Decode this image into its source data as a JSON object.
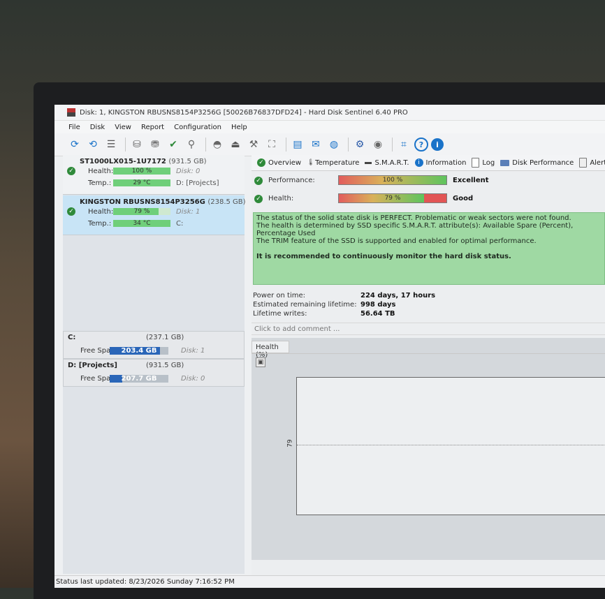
{
  "window": {
    "title": "Disk: 1, KINGSTON RBUSNS8154P3256G [50026B76837DFD24]  -  Hard Disk Sentinel 6.40 PRO"
  },
  "menu": [
    "File",
    "Disk",
    "View",
    "Report",
    "Configuration",
    "Help"
  ],
  "toolbar": {
    "icons": [
      "refresh-icon",
      "refresh-warning-icon",
      "list-icon",
      "disk-test-icon",
      "disk-schedule-icon",
      "disk-check-icon",
      "disk-search-icon",
      "drive-icon",
      "eject-icon",
      "tools-icon",
      "drive-share-icon",
      "notes-icon",
      "mail-icon",
      "globe-icon",
      "settings-icon",
      "sound-icon",
      "screenshot-icon",
      "help-icon",
      "info-icon"
    ]
  },
  "disks": [
    {
      "name": "ST1000LX015-1U7172",
      "capacity": "(931.5 GB)",
      "health_label": "Health:",
      "health": "100 %",
      "health_fraction": 1.0,
      "disk_meta": "Disk: 0",
      "temp_label": "Temp.:",
      "temp": "29 °C",
      "volume": "D: [Projects]"
    },
    {
      "name": "KINGSTON RBUSNS8154P3256G",
      "capacity": "(238.5 GB)",
      "health_label": "Health:",
      "health": "79 %",
      "health_fraction": 0.79,
      "disk_meta": "Disk: 1",
      "temp_label": "Temp.:",
      "temp": "34 °C",
      "volume": "C:"
    }
  ],
  "volumes": [
    {
      "name": "C:",
      "capacity": "(237.1 GB)",
      "free_label": "Free Space",
      "free": "203.4 GB",
      "free_fraction": 0.86,
      "disk": "Disk: 1"
    },
    {
      "name": "D: [Projects]",
      "capacity": "(931.5 GB)",
      "free_label": "Free Space",
      "free": "207.7 GB",
      "free_fraction": 0.22,
      "disk": "Disk: 0"
    }
  ],
  "tabs": [
    "Overview",
    "Temperature",
    "S.M.A.R.T.",
    "Information",
    "Log",
    "Disk Performance",
    "Alerts"
  ],
  "overview": {
    "performance_label": "Performance:",
    "performance": "100 %",
    "performance_fraction": 1.0,
    "performance_word": "Excellent",
    "health_label": "Health:",
    "health": "79 %",
    "health_fraction": 0.79,
    "health_word": "Good",
    "status_lines": [
      "The status of the solid state disk is PERFECT. Problematic or weak sectors were not found.",
      "The health is determined by SSD specific S.M.A.R.T. attribute(s):  Available Spare (Percent), Percentage Used",
      "The TRIM feature of the SSD is supported and enabled for optimal performance."
    ],
    "recommendation": "It is recommended to continuously monitor the hard disk status.",
    "stats": [
      {
        "label": "Power on time:",
        "value": "224 days, 17 hours"
      },
      {
        "label": "Estimated remaining lifetime:",
        "value": "998 days"
      },
      {
        "label": "Lifetime writes:",
        "value": "56.64 TB"
      }
    ],
    "comment_placeholder": "Click to add comment ..."
  },
  "graph": {
    "tab_label": "Health (%)",
    "ytick": "79"
  },
  "status_bar": "Status last updated: 8/23/2026 Sunday 7:16:52 PM",
  "colors": {
    "selected_disk": "#c8e4f6",
    "status_box": "#9fd9a3",
    "health_bar": "#6fcf7a",
    "volume_bar": "#2a66b8"
  }
}
